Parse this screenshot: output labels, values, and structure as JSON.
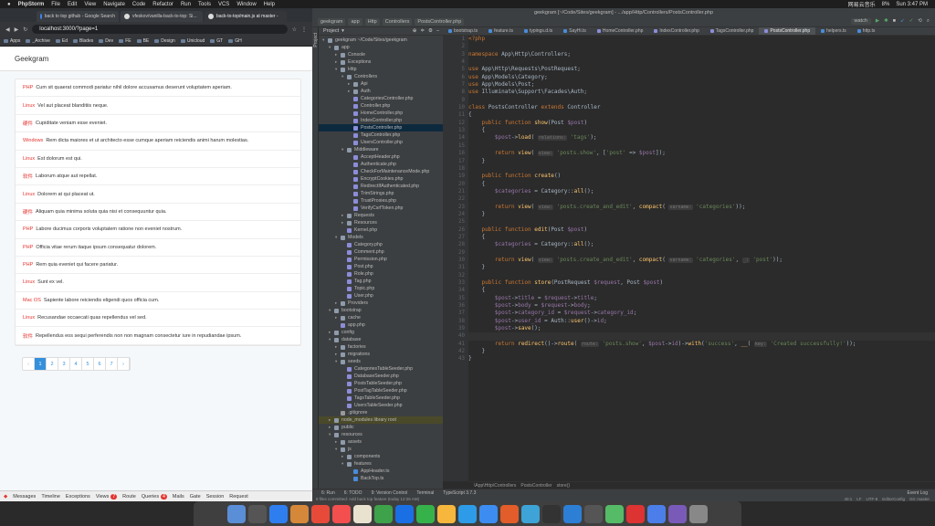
{
  "menubar": {
    "app": "PhpStorm",
    "items": [
      "File",
      "Edit",
      "View",
      "Navigate",
      "Code",
      "Refactor",
      "Run",
      "Tools",
      "VCS",
      "Window",
      "Help"
    ],
    "right": [
      "网易云音乐",
      "8%",
      "Sun 3:47 PM"
    ]
  },
  "browser": {
    "tabs": [
      {
        "title": "back to top github - Google Search",
        "color": "#4285f4"
      },
      {
        "title": "vfeskov/vanilla-back-to-top: Si...",
        "color": "#ddd"
      },
      {
        "title": "back-to-top/main.js at master -",
        "color": "#ddd"
      }
    ],
    "url": "localhost:3000/?page=1",
    "bookmarks": [
      "Apps",
      "_Archive",
      "Ed",
      "Blades",
      "Dev",
      "FE",
      "BE",
      "Design",
      "Unicloud",
      "GT",
      "GH"
    ],
    "brand": "Geekgram",
    "posts": [
      {
        "cat": "PHP",
        "title": "Cum sit quaerat commodi pariatur nihil dolore accusamus deserunt voluptatem aperiam."
      },
      {
        "cat": "Linux",
        "title": "Vel aut placeat blanditiis neque."
      },
      {
        "cat": "硬件",
        "title": "Cupiditate veniam esse eveniet."
      },
      {
        "cat": "Windows",
        "title": "Rem dicta maiores et ut architecto esse cumque aperiam reiciendis animi harum molestias."
      },
      {
        "cat": "Linux",
        "title": "Est dolorum est qui."
      },
      {
        "cat": "软件",
        "title": "Laborum atque aut repellat."
      },
      {
        "cat": "Linux",
        "title": "Dolorem at qui placeat ut."
      },
      {
        "cat": "硬件",
        "title": "Aliquam quia minima soluta quia nisi et consequuntur quia."
      },
      {
        "cat": "PHP",
        "title": "Labore ducimus corporis voluptatem ratione non eveniet nostrum."
      },
      {
        "cat": "PHP",
        "title": "Officia vitae rerum itaque ipsum consequatur dolorem."
      },
      {
        "cat": "PHP",
        "title": "Rem quia eveniet qui facere pariatur."
      },
      {
        "cat": "Linux",
        "title": "Sunt ex vel."
      },
      {
        "cat": "Mac OS",
        "title": "Sapiente labore reiciendis eligendi quos officia cum."
      },
      {
        "cat": "Linux",
        "title": "Recusandae occaecati quas repellendus vel sed."
      },
      {
        "cat": "软件",
        "title": "Repellendus eos sequi perferendis non non magnam consectetur iure in repudiandae ipsum."
      }
    ],
    "pages": [
      "‹",
      "1",
      "2",
      "3",
      "4",
      "5",
      "6",
      "7",
      "›"
    ],
    "debugbar": [
      {
        "label": "Messages"
      },
      {
        "label": "Timeline"
      },
      {
        "label": "Exceptions"
      },
      {
        "label": "Views",
        "badge": "7"
      },
      {
        "label": "Route"
      },
      {
        "label": "Queries",
        "badge": "4"
      },
      {
        "label": "Mails"
      },
      {
        "label": "Gate"
      },
      {
        "label": "Session"
      },
      {
        "label": "Request"
      }
    ]
  },
  "ide": {
    "title": "geekgram [~/Code/Sites/geekgram] - .../app/Http/Controllers/PostsController.php",
    "breadcrumb": [
      "geekgram",
      "app",
      "Http",
      "Controllers",
      "PostsController.php"
    ],
    "project_label": "Project",
    "tree": [
      {
        "d": 0,
        "t": "folder",
        "n": "geekgram ~/Code/Sites/geekgram",
        "o": "▾"
      },
      {
        "d": 1,
        "t": "folder",
        "n": "app",
        "o": "▾"
      },
      {
        "d": 2,
        "t": "folder",
        "n": "Console",
        "o": "▸"
      },
      {
        "d": 2,
        "t": "folder",
        "n": "Exceptions",
        "o": "▸"
      },
      {
        "d": 2,
        "t": "folder",
        "n": "Http",
        "o": "▾"
      },
      {
        "d": 3,
        "t": "folder",
        "n": "Controllers",
        "o": "▾"
      },
      {
        "d": 4,
        "t": "folder",
        "n": "Api",
        "o": "▸"
      },
      {
        "d": 4,
        "t": "folder",
        "n": "Auth",
        "o": "▸"
      },
      {
        "d": 4,
        "t": "php",
        "n": "CategoriesController.php"
      },
      {
        "d": 4,
        "t": "php",
        "n": "Controller.php"
      },
      {
        "d": 4,
        "t": "php",
        "n": "HomeController.php"
      },
      {
        "d": 4,
        "t": "php",
        "n": "IndexController.php"
      },
      {
        "d": 4,
        "t": "php",
        "n": "PostsController.php",
        "sel": true
      },
      {
        "d": 4,
        "t": "php",
        "n": "TagsController.php"
      },
      {
        "d": 4,
        "t": "php",
        "n": "UsersController.php"
      },
      {
        "d": 3,
        "t": "folder",
        "n": "Middleware",
        "o": "▾"
      },
      {
        "d": 4,
        "t": "php",
        "n": "AcceptHeader.php"
      },
      {
        "d": 4,
        "t": "php",
        "n": "Authenticate.php"
      },
      {
        "d": 4,
        "t": "php",
        "n": "CheckForMaintenanceMode.php"
      },
      {
        "d": 4,
        "t": "php",
        "n": "EncryptCookies.php"
      },
      {
        "d": 4,
        "t": "php",
        "n": "RedirectIfAuthenticated.php"
      },
      {
        "d": 4,
        "t": "php",
        "n": "TrimStrings.php"
      },
      {
        "d": 4,
        "t": "php",
        "n": "TrustProxies.php"
      },
      {
        "d": 4,
        "t": "php",
        "n": "VerifyCsrfToken.php"
      },
      {
        "d": 3,
        "t": "folder",
        "n": "Requests",
        "o": "▸"
      },
      {
        "d": 3,
        "t": "folder",
        "n": "Resources",
        "o": "▸"
      },
      {
        "d": 3,
        "t": "php",
        "n": "Kernel.php"
      },
      {
        "d": 2,
        "t": "folder",
        "n": "Models",
        "o": "▾"
      },
      {
        "d": 3,
        "t": "php",
        "n": "Category.php"
      },
      {
        "d": 3,
        "t": "php",
        "n": "Comment.php"
      },
      {
        "d": 3,
        "t": "php",
        "n": "Permission.php"
      },
      {
        "d": 3,
        "t": "php",
        "n": "Post.php"
      },
      {
        "d": 3,
        "t": "php",
        "n": "Role.php"
      },
      {
        "d": 3,
        "t": "php",
        "n": "Tag.php"
      },
      {
        "d": 3,
        "t": "php",
        "n": "Topic.php"
      },
      {
        "d": 3,
        "t": "php",
        "n": "User.php"
      },
      {
        "d": 2,
        "t": "folder",
        "n": "Providers",
        "o": "▸"
      },
      {
        "d": 1,
        "t": "folder",
        "n": "bootstrap",
        "o": "▾"
      },
      {
        "d": 2,
        "t": "folder",
        "n": "cache",
        "o": "▸"
      },
      {
        "d": 2,
        "t": "php",
        "n": "app.php"
      },
      {
        "d": 1,
        "t": "folder",
        "n": "config",
        "o": "▸"
      },
      {
        "d": 1,
        "t": "folder",
        "n": "database",
        "o": "▾"
      },
      {
        "d": 2,
        "t": "folder",
        "n": "factories",
        "o": "▸"
      },
      {
        "d": 2,
        "t": "folder",
        "n": "migrations",
        "o": "▸"
      },
      {
        "d": 2,
        "t": "folder",
        "n": "seeds",
        "o": "▾"
      },
      {
        "d": 3,
        "t": "php",
        "n": "CategoriesTableSeeder.php"
      },
      {
        "d": 3,
        "t": "php",
        "n": "DatabaseSeeder.php"
      },
      {
        "d": 3,
        "t": "php",
        "n": "PostsTableSeeder.php"
      },
      {
        "d": 3,
        "t": "php",
        "n": "PostTagTableSeeder.php"
      },
      {
        "d": 3,
        "t": "php",
        "n": "TagsTableSeeder.php"
      },
      {
        "d": 3,
        "t": "php",
        "n": "UsersTableSeeder.php"
      },
      {
        "d": 2,
        "t": "txt",
        "n": ".gitignore"
      },
      {
        "d": 1,
        "t": "folder",
        "n": "node_modules  library root",
        "o": "▸",
        "hl": true
      },
      {
        "d": 1,
        "t": "folder",
        "n": "public",
        "o": "▸"
      },
      {
        "d": 1,
        "t": "folder",
        "n": "resources",
        "o": "▾"
      },
      {
        "d": 2,
        "t": "folder",
        "n": "assets",
        "o": "▸"
      },
      {
        "d": 2,
        "t": "folder",
        "n": "js",
        "o": "▾"
      },
      {
        "d": 3,
        "t": "folder",
        "n": "components",
        "o": "▸"
      },
      {
        "d": 3,
        "t": "folder",
        "n": "features",
        "o": "▾"
      },
      {
        "d": 4,
        "t": "ts",
        "n": "AppHeader.ts"
      },
      {
        "d": 4,
        "t": "ts",
        "n": "BackTop.ts"
      }
    ],
    "tabs": [
      {
        "n": "bootstrap.ts"
      },
      {
        "n": "feature.ts"
      },
      {
        "n": "typings.d.ts"
      },
      {
        "n": "SayHi.ts"
      },
      {
        "n": "HomeController.php"
      },
      {
        "n": "IndexController.php"
      },
      {
        "n": "TagsController.php"
      },
      {
        "n": "PostsController.php",
        "active": true
      },
      {
        "n": "helpers.ts"
      },
      {
        "n": "http.ts"
      }
    ],
    "code_breadcrumb": [
      "\\App\\Http\\Controllers",
      "PostsController",
      "store()"
    ],
    "bottom_tabs": [
      "6: Run",
      "6: TODO",
      "9: Version Control",
      "Terminal",
      "TypeScript 3.7.3"
    ],
    "status_left": "9 files committed: Add back top feature (today 12:26 AM)",
    "status_right": [
      "40:1",
      "LF",
      "UTF-8",
      "EditorConfig",
      "Git: master"
    ],
    "run_config": "watch"
  },
  "dock": [
    "#5a8ed6",
    "#555",
    "#2f7ef0",
    "#d5883a",
    "#e84a3a",
    "#f34f4f",
    "#e9e2cf",
    "#3da24a",
    "#1a6fe5",
    "#36b24b",
    "#f6b73c",
    "#2d9be8",
    "#3c8cf2",
    "#e25d2a",
    "#3ea3d6",
    "#333",
    "#2d7fd6",
    "#555",
    "#5b6",
    "#d33",
    "#4b7ee8",
    "#7a5ab8",
    "#888"
  ]
}
